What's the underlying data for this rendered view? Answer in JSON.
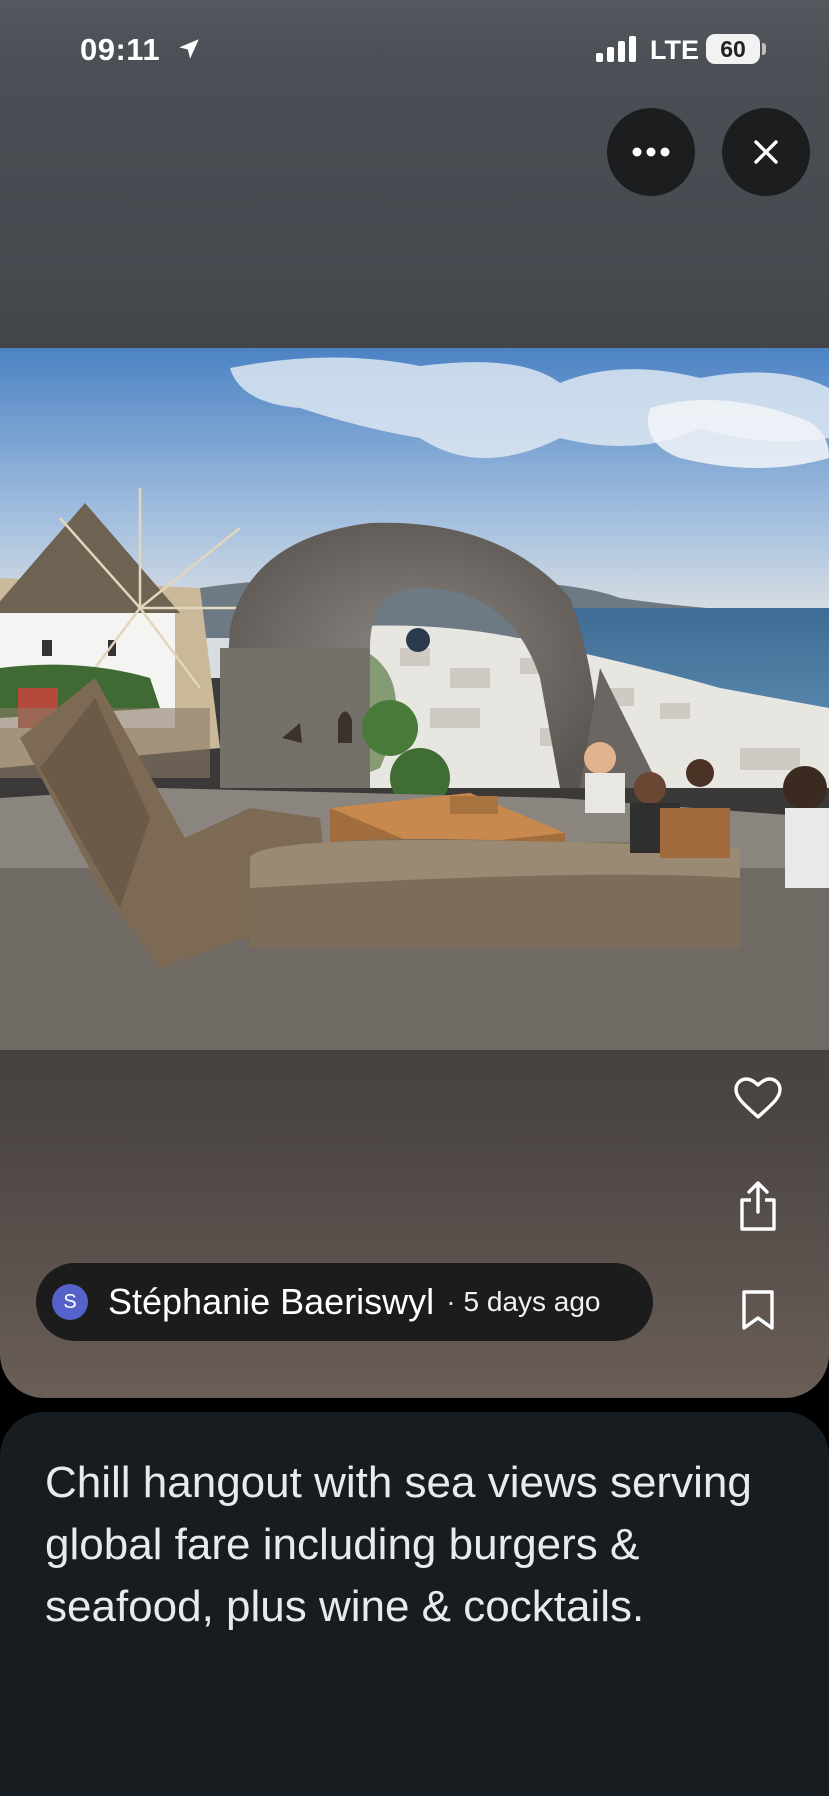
{
  "status_bar": {
    "time": "09:11",
    "location_icon": "location-arrow-icon",
    "signal_icon": "cellular-signal-icon",
    "network": "LTE",
    "battery": "60"
  },
  "top_actions": {
    "more_icon": "more-horizontal-icon",
    "close_icon": "close-icon"
  },
  "photo": {
    "icon": "photo-image"
  },
  "side_actions": {
    "like_icon": "heart-icon",
    "share_icon": "share-icon",
    "save_icon": "bookmark-icon"
  },
  "author": {
    "initial": "S",
    "name": "Stéphanie Baeriswyl",
    "separator": "·",
    "posted": "5 days ago",
    "avatar_color": "#5562c9"
  },
  "description": "Chill hangout with sea views serving global fare including burgers & seafood, plus wine & cocktails."
}
